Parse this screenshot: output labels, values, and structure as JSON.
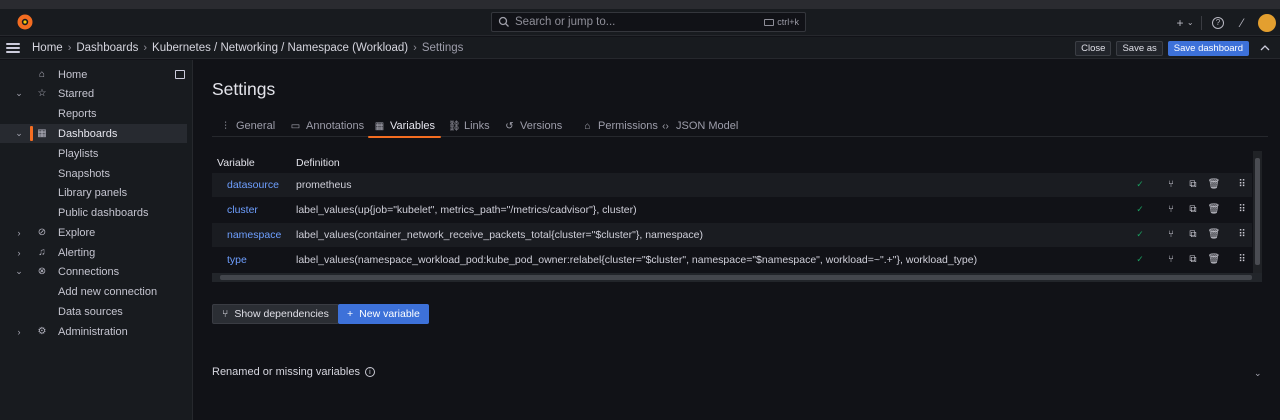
{
  "colors": {
    "accent": "#f46d21",
    "primary": "#3d71d9",
    "link": "#6e9fff",
    "success": "#1a9f5f"
  },
  "topbar": {
    "search_placeholder": "Search or jump to...",
    "search_shortcut": "ctrl+k",
    "plus_label": "+",
    "plus_chevron": "⌄",
    "help_glyph": "?",
    "news_glyph": "⁄"
  },
  "breadcrumb": {
    "items": [
      "Home",
      "Dashboards",
      "Kubernetes / Networking / Namespace (Workload)",
      "Settings"
    ],
    "separator": "›"
  },
  "toolbar": {
    "close_label": "Close",
    "save_as_label": "Save as",
    "save_dashboard_label": "Save dashboard"
  },
  "sidebar": {
    "items": [
      {
        "label": "Home",
        "expand": "",
        "icon": "⌂"
      },
      {
        "label": "Starred",
        "expand": "⌄",
        "icon": "☆"
      },
      {
        "label": "Reports",
        "expand": "",
        "icon": ""
      },
      {
        "label": "Dashboards",
        "expand": "⌄",
        "icon": "▦"
      },
      {
        "label": "Playlists",
        "expand": "",
        "icon": ""
      },
      {
        "label": "Snapshots",
        "expand": "",
        "icon": ""
      },
      {
        "label": "Library panels",
        "expand": "",
        "icon": ""
      },
      {
        "label": "Public dashboards",
        "expand": "",
        "icon": ""
      },
      {
        "label": "Explore",
        "expand": "›",
        "icon": "⊘"
      },
      {
        "label": "Alerting",
        "expand": "›",
        "icon": "♫"
      },
      {
        "label": "Connections",
        "expand": "⌄",
        "icon": "⊗"
      },
      {
        "label": "Add new connection",
        "expand": "",
        "icon": ""
      },
      {
        "label": "Data sources",
        "expand": "",
        "icon": ""
      },
      {
        "label": "Administration",
        "expand": "›",
        "icon": "⚙"
      }
    ]
  },
  "page": {
    "title": "Settings"
  },
  "tabs": [
    {
      "label": "General",
      "icon": "⫶"
    },
    {
      "label": "Annotations",
      "icon": "▭"
    },
    {
      "label": "Variables",
      "icon": "▦"
    },
    {
      "label": "Links",
      "icon": "⛓"
    },
    {
      "label": "Versions",
      "icon": "↺"
    },
    {
      "label": "Permissions",
      "icon": "⌂"
    },
    {
      "label": "JSON Model",
      "icon": "‹›"
    }
  ],
  "variables_table": {
    "headers": [
      "Variable",
      "Definition"
    ],
    "rows": [
      {
        "name": "datasource",
        "definition": "prometheus"
      },
      {
        "name": "cluster",
        "definition": "label_values(up{job=\"kubelet\", metrics_path=\"/metrics/cadvisor\"}, cluster)"
      },
      {
        "name": "namespace",
        "definition": "label_values(container_network_receive_packets_total{cluster=\"$cluster\"}, namespace)"
      },
      {
        "name": "type",
        "definition": "label_values(namespace_workload_pod:kube_pod_owner:relabel{cluster=\"$cluster\", namespace=\"$namespace\", workload=~\".+\"}, workload_type)"
      }
    ],
    "row_actions": {
      "check": "✓",
      "dependencies": "⑂",
      "duplicate": "⧉",
      "delete": "🗑",
      "drag": "⠿"
    }
  },
  "buttons": {
    "show_dependencies": "Show dependencies",
    "new_variable": "New variable",
    "new_variable_prefix": "+"
  },
  "renamed_section": {
    "label": "Renamed or missing variables",
    "info_glyph": "i",
    "chevron": "⌄"
  }
}
